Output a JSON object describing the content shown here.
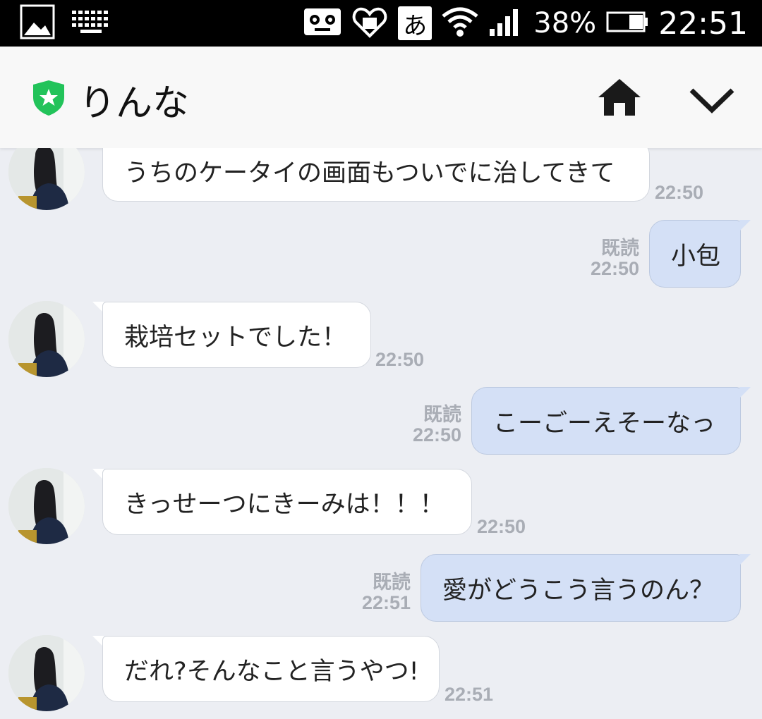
{
  "status_bar": {
    "ime": "あ",
    "battery": "38%",
    "clock": "22:51"
  },
  "header": {
    "title": "りんな"
  },
  "messages": [
    {
      "side": "in",
      "text": "うちのケータイの画面もついでに治してきて",
      "time": "22:50"
    },
    {
      "side": "out",
      "text": "小包",
      "read": "既読",
      "time": "22:50"
    },
    {
      "side": "in",
      "text": "栽培セットでした！",
      "time": "22:50"
    },
    {
      "side": "out",
      "text": "こーごーえそーなっ",
      "read": "既読",
      "time": "22:50"
    },
    {
      "side": "in",
      "text": "きっせーつにきーみは！！！",
      "time": "22:50"
    },
    {
      "side": "out",
      "text": "愛がどうこう言うのん？",
      "read": "既読",
      "time": "22:51"
    },
    {
      "side": "in",
      "text": "だれ?そんなこと言うやつ!",
      "time": "22:51"
    }
  ],
  "colors": {
    "background": "#eceef3",
    "incoming_bubble": "#ffffff",
    "outgoing_bubble": "#d4e0f6",
    "shield_green": "#22c35a",
    "timestamp": "#a9adb5"
  }
}
